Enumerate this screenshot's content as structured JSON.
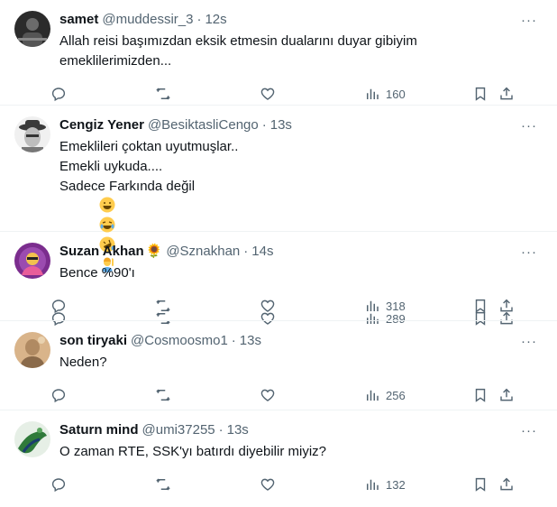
{
  "tweets": [
    {
      "name": "samet",
      "handle": "@muddessir_3",
      "time": "12s",
      "lines": [
        "Allah reisi başımızdan eksik etmesin dualarını duyar gibiyim",
        "emeklilerimizden..."
      ],
      "views": "160",
      "avatar_colors": [
        "#2b2b2b",
        "#6b6b6b"
      ]
    },
    {
      "name": "Cengiz Yener",
      "handle": "@BesiktasliCengo",
      "time": "13s",
      "lines": [
        "Emeklileri çoktan uyutmuşlar..",
        "Emekli uykuda....",
        "Sadece Farkında değil"
      ],
      "emojis": [
        "grinning-face-emoji",
        "tears-of-joy-emoji",
        "rolling-laughing-emoji",
        "person-raising-hand-emoji"
      ],
      "views": "289",
      "avatar_colors": [
        "#e8e8e8",
        "#3a3a3a"
      ]
    },
    {
      "name": "Suzan Akhan",
      "name_emoji": "🌻",
      "handle": "@Sznakhan",
      "time": "14s",
      "lines": [
        "Bence %90'ı"
      ],
      "views": "318",
      "avatar_colors": [
        "#7b2d8e",
        "#f2c14e"
      ]
    },
    {
      "name": "son tiryaki",
      "handle": "@Cosmoosmo1",
      "time": "13s",
      "lines": [
        "Neden?"
      ],
      "views": "256",
      "avatar_colors": [
        "#d9b48a",
        "#8a6a4a"
      ]
    },
    {
      "name": "Saturn mind",
      "handle": "@umi37255",
      "time": "13s",
      "lines": [
        "O zaman RTE, SSK'yı batırdı diyebilir miyiz?"
      ],
      "views": "132",
      "avatar_colors": [
        "#2f7a3a",
        "#1b3d6e"
      ]
    }
  ],
  "more_glyph": "···",
  "icon_color": "#536471"
}
